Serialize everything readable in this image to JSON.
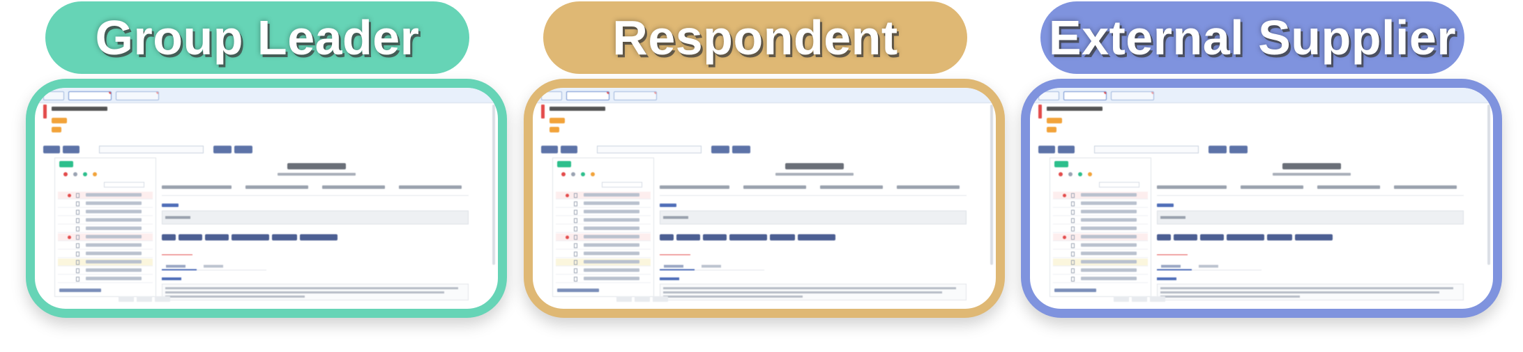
{
  "panels": [
    {
      "role_title": "Group Leader",
      "pill_color": "#66d4b6",
      "frame_color": "#66d4b6"
    },
    {
      "role_title": "Respondent",
      "pill_color": "#dfb874",
      "frame_color": "#dfb874"
    },
    {
      "role_title": "External Supplier",
      "pill_color": "#7f93de",
      "frame_color": "#7f93de"
    }
  ],
  "colors": {
    "accent_red": "#e34b4b",
    "badge_orange": "#f2a33a",
    "tag_green": "#2dbf8c",
    "button_navy": "#4c5f93"
  }
}
